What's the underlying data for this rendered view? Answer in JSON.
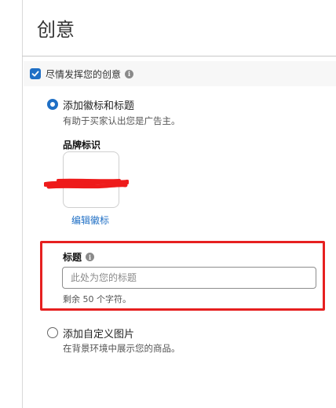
{
  "page": {
    "title": "创意"
  },
  "creative_toggle": {
    "label": "尽情发挥您的创意",
    "checked": true
  },
  "options": [
    {
      "label": "添加徽标和标题",
      "help": "有助于买家认出您是广告主。",
      "selected": true
    },
    {
      "label": "添加自定义图片",
      "help": "在背景环境中展示您的商品。",
      "selected": false
    }
  ],
  "brand_logo": {
    "label": "品牌标识",
    "edit_link": "编辑徽标"
  },
  "headline": {
    "label": "标题",
    "placeholder": "此处为您的标题",
    "value": "",
    "remaining": "剩余 50 个字符。"
  },
  "colors": {
    "accent": "#1f6fc5",
    "highlight": "#e62020",
    "redaction": "#ee1b1b"
  },
  "icons": {
    "info": "info-icon",
    "check": "checkmark-icon"
  }
}
